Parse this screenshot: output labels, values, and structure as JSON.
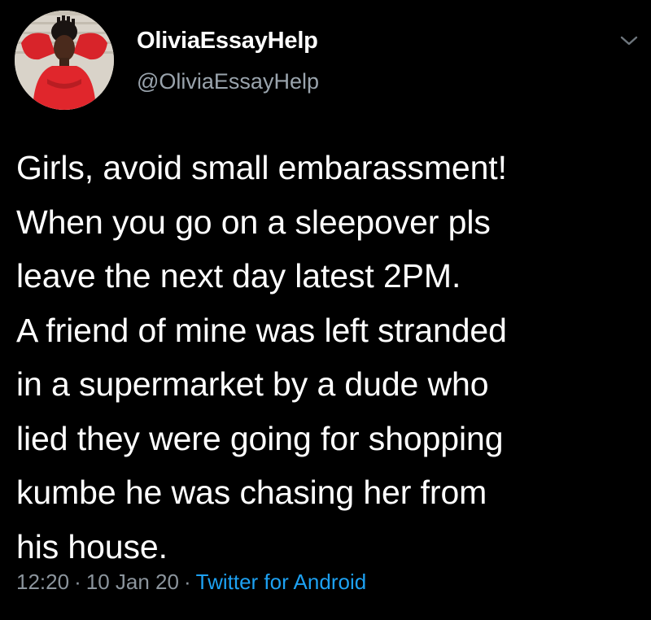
{
  "user": {
    "display_name": "OliviaEssayHelp",
    "handle": "@OliviaEssayHelp",
    "avatar_icon": "profile-photo"
  },
  "menu": {
    "icon": "chevron-down-icon"
  },
  "tweet": {
    "lines": [
      "Girls, avoid small embarassment!",
      "When you go on a sleepover pls",
      "leave the next day latest 2PM.",
      "A friend of mine was left stranded",
      "in a supermarket by a dude who",
      "lied they were going for shopping",
      "kumbe he was chasing her from",
      "his house."
    ]
  },
  "meta": {
    "time": "12:20",
    "separator": "·",
    "date": "10 Jan 20",
    "source": "Twitter for Android"
  },
  "colors": {
    "background": "#000000",
    "text": "#ffffff",
    "secondary": "#8c959d",
    "link": "#1da1f2"
  }
}
